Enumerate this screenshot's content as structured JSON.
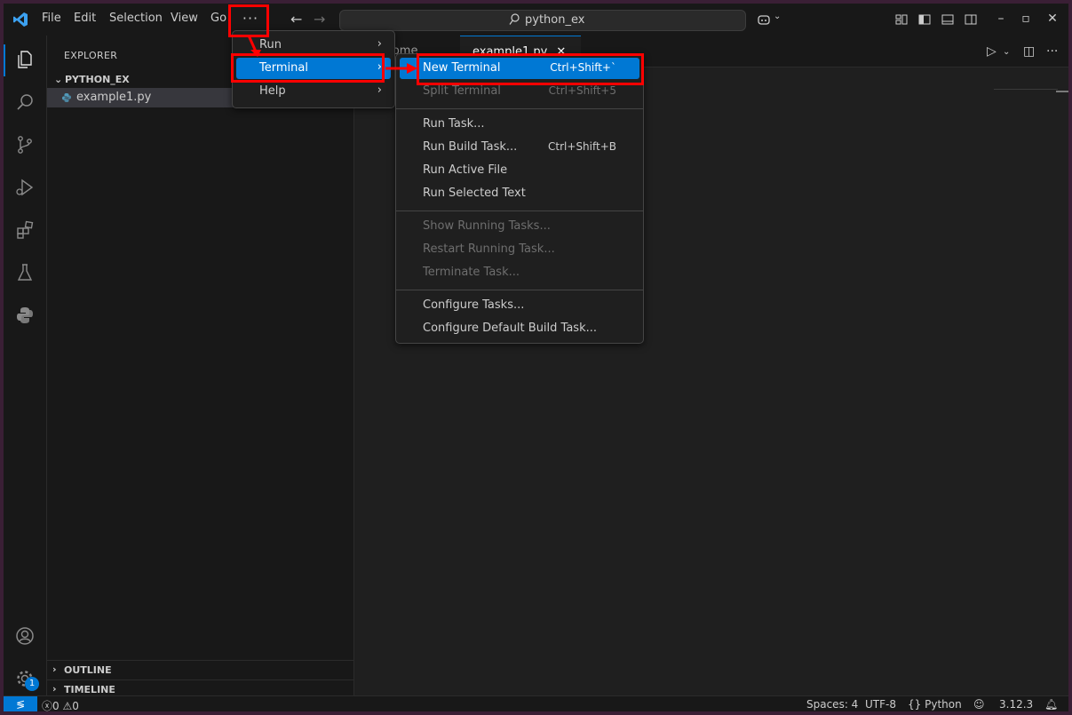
{
  "titlebar": {
    "menu": [
      "File",
      "Edit",
      "Selection",
      "View",
      "Go"
    ],
    "more_label": "···",
    "search_text": "python_ex",
    "back_icon": "arrow-left-icon",
    "forward_icon": "arrow-right-icon",
    "window_controls": [
      "minimize",
      "maximize",
      "close"
    ]
  },
  "sidebar": {
    "title": "EXPLORER",
    "folder": "PYTHON_EX",
    "file": "example1.py",
    "outline": "OUTLINE",
    "timeline": "TIMELINE"
  },
  "tabs": [
    {
      "label": "Welcome",
      "active": false
    },
    {
      "label": "example1.py",
      "active": true
    }
  ],
  "main_menu": {
    "items": [
      {
        "label": "Run",
        "submenu": true
      },
      {
        "label": "Terminal",
        "submenu": true,
        "highlighted": true
      },
      {
        "label": "Help",
        "submenu": true
      }
    ]
  },
  "terminal_menu": {
    "groups": [
      [
        {
          "label": "New Terminal",
          "shortcut": "Ctrl+Shift+`",
          "highlighted": true,
          "enabled": true
        },
        {
          "label": "Split Terminal",
          "shortcut": "Ctrl+Shift+5",
          "enabled": false
        }
      ],
      [
        {
          "label": "Run Task...",
          "shortcut": "",
          "enabled": true
        },
        {
          "label": "Run Build Task...",
          "shortcut": "Ctrl+Shift+B",
          "enabled": true
        },
        {
          "label": "Run Active File",
          "shortcut": "",
          "enabled": true
        },
        {
          "label": "Run Selected Text",
          "shortcut": "",
          "enabled": true
        }
      ],
      [
        {
          "label": "Show Running Tasks...",
          "shortcut": "",
          "enabled": false
        },
        {
          "label": "Restart Running Task...",
          "shortcut": "",
          "enabled": false
        },
        {
          "label": "Terminate Task...",
          "shortcut": "",
          "enabled": false
        }
      ],
      [
        {
          "label": "Configure Tasks...",
          "shortcut": "",
          "enabled": true
        },
        {
          "label": "Configure Default Build Task...",
          "shortcut": "",
          "enabled": true
        }
      ]
    ]
  },
  "statusbar": {
    "errors": "0",
    "warnings": "0",
    "spaces": "Spaces: 4",
    "encoding": "UTF-8",
    "language": "Python",
    "language_icon": "{}",
    "version": "3.12.3"
  },
  "activitybar": {
    "icons": [
      "explorer-icon",
      "search-icon",
      "source-control-icon",
      "run-debug-icon",
      "extensions-icon",
      "testing-icon",
      "python-icon"
    ],
    "accounts_icon": "accounts-icon",
    "settings_icon": "gear-icon",
    "settings_badge": "1"
  },
  "colors": {
    "accent": "#0078d4",
    "annotation": "#ff0000"
  }
}
